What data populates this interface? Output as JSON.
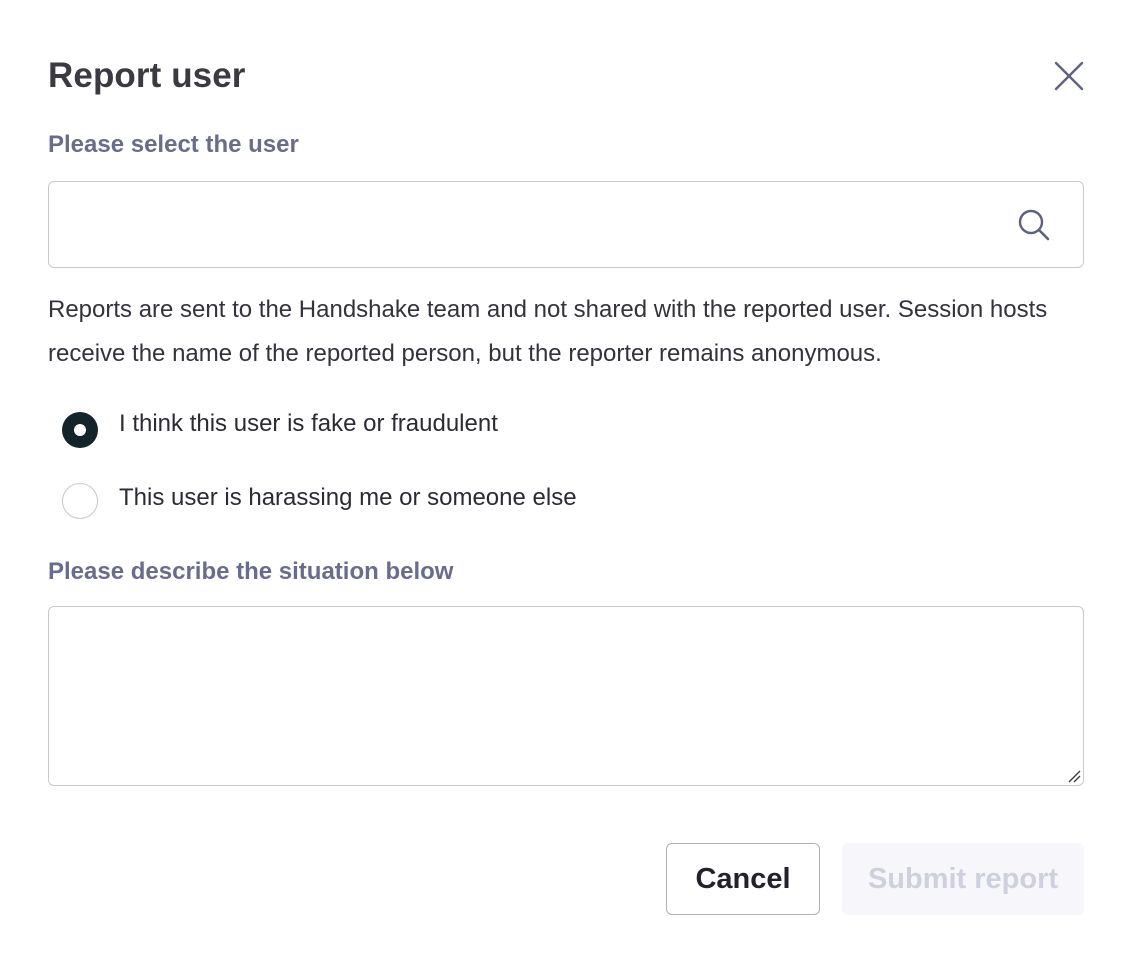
{
  "dialog": {
    "title": "Report user",
    "close_icon": "close-icon"
  },
  "user_select": {
    "label": "Please select the user",
    "value": "",
    "placeholder": "",
    "icon": "search-icon"
  },
  "notice": "Reports are sent to the Handshake team and not shared with the reported user. Session hosts receive the name of the reported person, but the reporter remains anonymous.",
  "reasons": {
    "selected_index": 0,
    "options": [
      {
        "label": "I think this user is fake or fraudulent",
        "checked": true
      },
      {
        "label": "This user is harassing me or someone else",
        "checked": false
      }
    ]
  },
  "description": {
    "label": "Please describe the situation below",
    "value": "",
    "placeholder": ""
  },
  "actions": {
    "cancel_label": "Cancel",
    "submit_label": "Submit report",
    "submit_disabled": true
  },
  "colors": {
    "label": "#6a6c8c",
    "radio_checked": "#15232a",
    "submit_disabled_bg": "#f6f6fb",
    "submit_disabled_text": "#cfd0dd"
  }
}
